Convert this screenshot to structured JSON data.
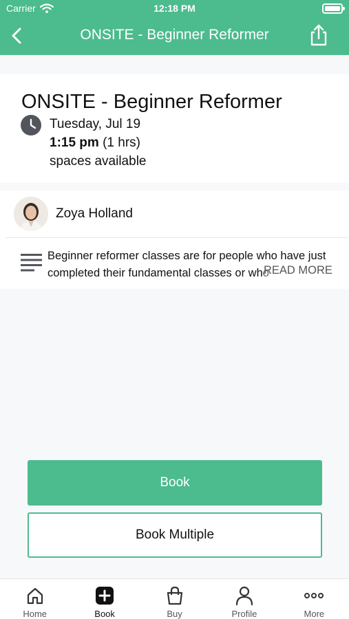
{
  "status_bar": {
    "carrier": "Carrier",
    "time": "12:18 PM"
  },
  "nav": {
    "title": "ONSITE - Beginner Reformer",
    "back_icon": "chevron-left-icon",
    "share_icon": "share-icon"
  },
  "class": {
    "title": "ONSITE - Beginner Reformer",
    "date": "Tuesday, Jul 19",
    "time": "1:15 pm",
    "duration": "(1 hrs)",
    "spaces": "spaces available"
  },
  "instructor": {
    "name": "Zoya Holland"
  },
  "description": {
    "text": "Beginner reformer classes are for people who have just completed their fundamental classes or who",
    "read_more": "READ MORE"
  },
  "actions": {
    "book_label": "Book",
    "book_multiple_label": "Book Multiple"
  },
  "tabs": [
    {
      "label": "Home",
      "icon": "home-icon"
    },
    {
      "label": "Book",
      "icon": "plus-square-icon"
    },
    {
      "label": "Buy",
      "icon": "shopping-bag-icon"
    },
    {
      "label": "Profile",
      "icon": "profile-icon"
    },
    {
      "label": "More",
      "icon": "more-dots-icon"
    }
  ],
  "colors": {
    "brand": "#4cbb8e",
    "background": "#f7f8fa"
  }
}
